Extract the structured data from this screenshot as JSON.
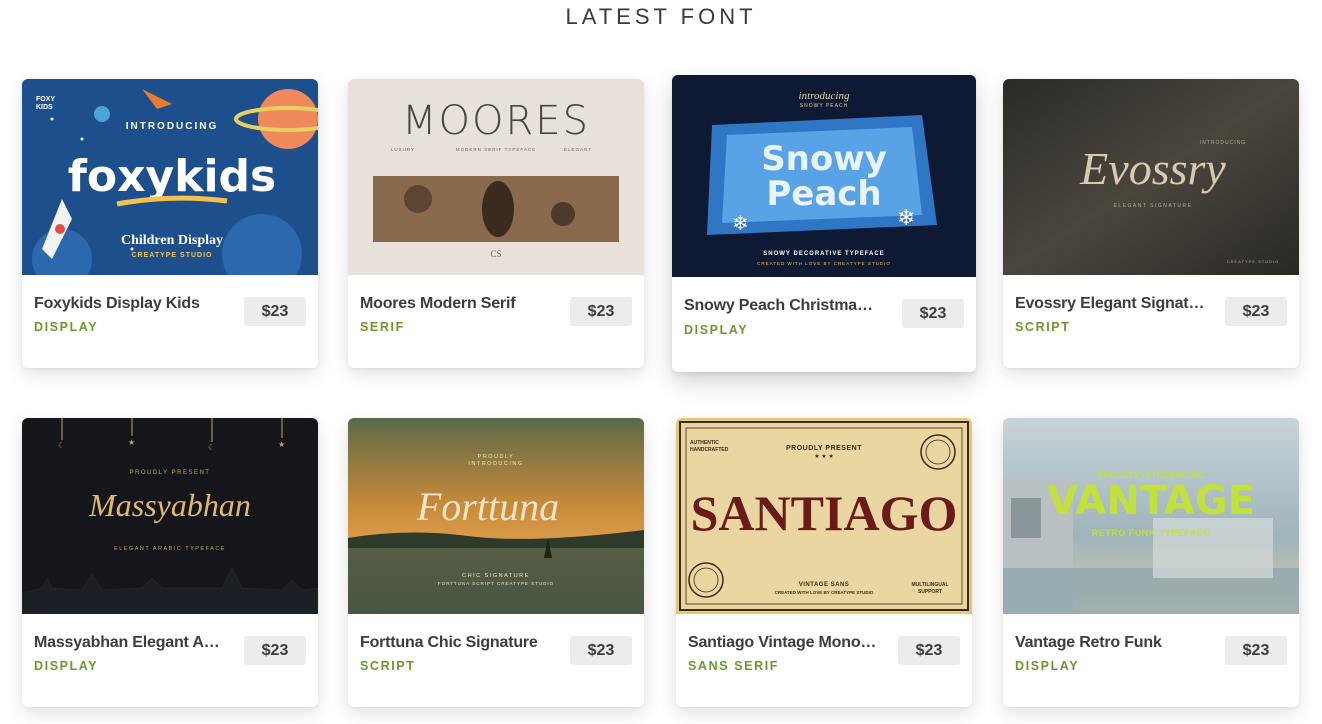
{
  "section": {
    "title": "LATEST FONT"
  },
  "cards": [
    {
      "name": "Foxykids Display Kids",
      "category": "DISPLAY",
      "price": "$23",
      "thumb": {
        "brand": "FOXY\nKIDS",
        "intro": "INTRODUCING",
        "title": "foxykids",
        "subtitle": "Children Display",
        "studio": "CREATYPE STUDIO"
      }
    },
    {
      "name": "Moores Modern Serif",
      "category": "SERIF",
      "price": "$23",
      "thumb": {
        "title": "MOORES",
        "tag1": "LUXURY",
        "tag2": "MODERN SERIF TYPEFACE",
        "tag3": "ELEGANT",
        "monogram": "CS"
      }
    },
    {
      "name": "Snowy Peach Christmas ...",
      "category": "DISPLAY",
      "price": "$23",
      "thumb": {
        "intro": "introducing",
        "intro2": "SNOWY PEACH",
        "title1": "Snowy",
        "title2": "Peach",
        "tagline": "SNOWY DECORATIVE TYPEFACE",
        "credit": "CREATED WITH LOVE BY CREATYPE STUDIO"
      }
    },
    {
      "name": "Evossry Elegant Signature",
      "category": "SCRIPT",
      "price": "$23",
      "thumb": {
        "title": "Evossry",
        "intro": "INTRODUCING",
        "subtitle": "ELEGANT SIGNATURE",
        "credit": "CREATYPE STUDIO"
      }
    },
    {
      "name": "Massyabhan Elegant Ara...",
      "category": "DISPLAY",
      "price": "$23",
      "thumb": {
        "intro": "PROUDLY PRESENT",
        "title": "Massyabhan",
        "subtitle": "ELEGANT ARABIC TYPEFACE"
      }
    },
    {
      "name": "Forttuna Chic Signature",
      "category": "SCRIPT",
      "price": "$23",
      "thumb": {
        "intro1": "PROUDLY",
        "intro2": "INTRODUCING",
        "title": "Forttuna",
        "subtitle": "CHIC SIGNATURE",
        "credit": "FORTTUNA SCRIPT CREATYPE STUDIO"
      }
    },
    {
      "name": "Santiago Vintage Monoline",
      "category": "SANS SERIF",
      "price": "$23",
      "thumb": {
        "intro": "PROUDLY PRESENT",
        "corner": "AUTHENTIC\nHANDCRAFTED",
        "title": "SANTIAGO",
        "subtitle": "VINTAGE SANS",
        "credit": "CREATED WITH LOVE BY CREATYPE STUDIO",
        "support": "MULTILINGUAL\nSUPPORT",
        "stamp": "CREATYPE STUDIO"
      }
    },
    {
      "name": "Vantage Retro Funk",
      "category": "DISPLAY",
      "price": "$23",
      "thumb": {
        "intro": "PROUDLY INTRODUCING",
        "title": "VANTAGE",
        "subtitle": "RETRO FUNK TYPEFACE"
      }
    }
  ],
  "colors": {
    "category": "#6a9a2c",
    "price_bg": "#ececec",
    "name": "#3d3d3d",
    "title": "#3a3a3a"
  }
}
